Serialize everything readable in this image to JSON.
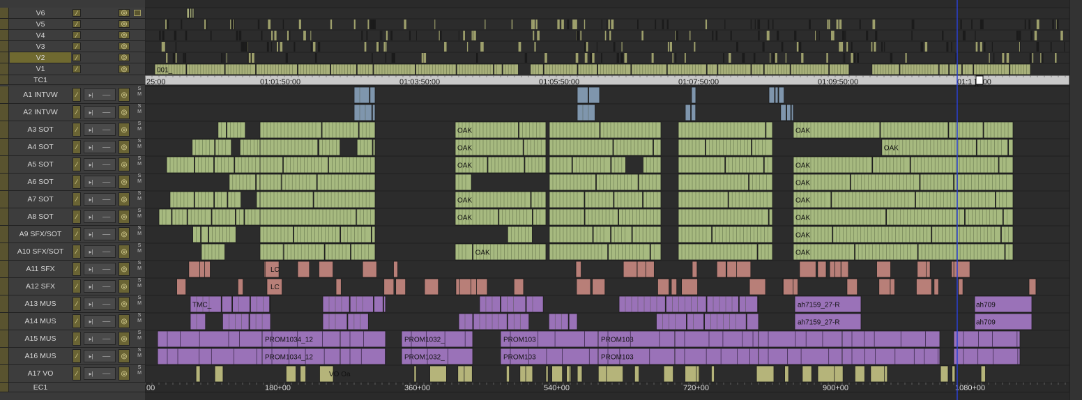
{
  "tracks": [
    {
      "id": "V6",
      "label": "V6",
      "kind": "video",
      "selected": false
    },
    {
      "id": "V5",
      "label": "V5",
      "kind": "video",
      "selected": false
    },
    {
      "id": "V4",
      "label": "V4",
      "kind": "video",
      "selected": false
    },
    {
      "id": "V3",
      "label": "V3",
      "kind": "video",
      "selected": false
    },
    {
      "id": "V2",
      "label": "V2",
      "kind": "video",
      "selected": true
    },
    {
      "id": "V1",
      "label": "V1",
      "kind": "video",
      "selected": false
    },
    {
      "id": "TC1",
      "label": "TC1",
      "kind": "timecode",
      "selected": false
    },
    {
      "id": "A1",
      "label": "A1 INTVW",
      "kind": "audio",
      "selected": false
    },
    {
      "id": "A2",
      "label": "A2 INTVW",
      "kind": "audio",
      "selected": false
    },
    {
      "id": "A3",
      "label": "A3 SOT",
      "kind": "audio",
      "selected": false
    },
    {
      "id": "A4",
      "label": "A4 SOT",
      "kind": "audio",
      "selected": false
    },
    {
      "id": "A5",
      "label": "A5 SOT",
      "kind": "audio",
      "selected": false
    },
    {
      "id": "A6",
      "label": "A6 SOT",
      "kind": "audio",
      "selected": false
    },
    {
      "id": "A7",
      "label": "A7 SOT",
      "kind": "audio",
      "selected": false
    },
    {
      "id": "A8",
      "label": "A8 SOT",
      "kind": "audio",
      "selected": false
    },
    {
      "id": "A9",
      "label": "A9 SFX/SOT",
      "kind": "audio",
      "selected": false
    },
    {
      "id": "A10",
      "label": "A10 SFX/SOT",
      "kind": "audio",
      "selected": false
    },
    {
      "id": "A11",
      "label": "A11 SFX",
      "kind": "audio",
      "selected": false
    },
    {
      "id": "A12",
      "label": "A12 SFX",
      "kind": "audio",
      "selected": false
    },
    {
      "id": "A13",
      "label": "A13 MUS",
      "kind": "audio",
      "selected": false
    },
    {
      "id": "A14",
      "label": "A14 MUS",
      "kind": "audio",
      "selected": false
    },
    {
      "id": "A15",
      "label": "A15 MUS",
      "kind": "audio",
      "selected": false
    },
    {
      "id": "A16",
      "label": "A16 MUS",
      "kind": "audio",
      "selected": false
    },
    {
      "id": "A17",
      "label": "A17 VO",
      "kind": "audio",
      "selected": false
    },
    {
      "id": "EC1",
      "label": "EC1",
      "kind": "edgecode",
      "selected": false
    }
  ],
  "header_controls": {
    "solo_label": "S",
    "mute_label": "M",
    "pen_glyph": "⁄",
    "monitor_glyph": "◎",
    "audio_glyph_1": "▸|",
    "audio_glyph_2": "──"
  },
  "timecode_ruler": {
    "labels": [
      "25:00:00",
      "01:01:50:00",
      "01:03:50:00",
      "01:05:50:00",
      "01:07:50:00",
      "01:09:50:00",
      "01:11:50:00"
    ],
    "visible_text": [
      "25:00",
      "01:01:50:00",
      "01:03:50:00",
      "01:05:50:00",
      "01:07:50:00",
      "01:09:50:00",
      "01:1 ][ :00"
    ]
  },
  "edgecode_ruler": {
    "visible_text": [
      "00",
      "180+00",
      "360+00",
      "540+00",
      "720+00",
      "900+00",
      "1080+00"
    ]
  },
  "clip_labels": {
    "v1": "001_",
    "music_a": "TMC_",
    "music_b": "PROM1034_12",
    "music_c": "PROM1032_",
    "music_d": "PROM103",
    "music_e": "ah7159_27-R",
    "music_f": "ah709",
    "sot": "OAK",
    "sfx": "LC",
    "vo": "VO Oa"
  },
  "colors": {
    "video_clip": "#a8b07a",
    "interview_clip": "#7f96ad",
    "sot_clip": "#a7ba80",
    "sfx_clip": "#b87f78",
    "music_clip": "#9a72b8",
    "vo_clip": "#b5b47a",
    "track_bg": "#2b2b2b",
    "playhead": "#2a3fd4"
  },
  "playhead_timecode_visible": "01:11:50:00"
}
